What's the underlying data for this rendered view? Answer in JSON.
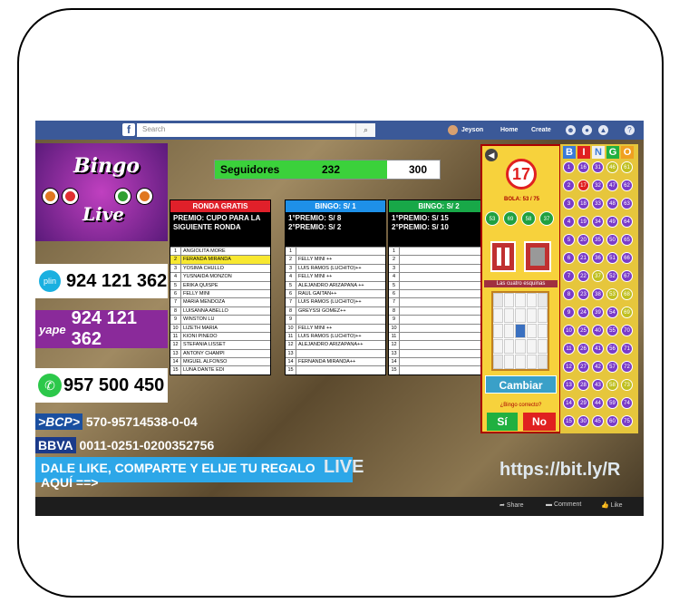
{
  "facebook": {
    "search_placeholder": "Search",
    "user": "Jeyson",
    "home": "Home",
    "create": "Create"
  },
  "stream": {
    "logo_line1": "Bingo",
    "logo_line2": "Live",
    "plin_label": "plin",
    "plin_number": "924 121 362",
    "yape_label": "yape",
    "yape_number": "924 121 362",
    "whatsapp_number": "957 500 450",
    "bcp_label": ">BCP>",
    "bcp_account": "570-95714538-0-04",
    "bbva_label": "BBVA",
    "bbva_account": "0011-0251-0200352756",
    "banner_text": "DALE LIKE, COMPARTE Y ELIJE TU REGALO AQUÍ ==>",
    "live_text": "LIVE",
    "url_text": "https://bit.ly/R",
    "seguidores_label": "Seguidores",
    "seguidores_count": "232",
    "seguidores_goal": "300"
  },
  "tables": [
    {
      "header": "RONDA GRATIS",
      "header_color": "#e0202a",
      "premio": "PREMIO: CUPO PARA LA SIGUIENTE RONDA",
      "rows": [
        "ANGIOLITA MORE",
        "FERANDA MIRANDA",
        "YOSIMA CHULLO",
        "YUSNAIDA MONZON",
        "ERIKA QUISPE",
        "FELLY MINI",
        "MARIA MENDOZA",
        "LUISANNA ABELLO",
        "WINSTON LU",
        "LIZETH MARIA",
        "KIONI PINEDO",
        "STEFANIA LISSET",
        "ANTONY CHAMPI",
        "MIGUEL ALFONSO",
        "LUNA DANTE EDI"
      ]
    },
    {
      "header": "BINGO: S/ 1",
      "header_color": "#1e90e8",
      "premio": "1°PREMIO: S/ 8\n2°PREMIO: S/ 2",
      "rows": [
        "",
        "FELLY MINI ++",
        "LUIS RAMOS (LUCHITO)++",
        "FELLY MINI ++",
        "ALEJANDRO ARIZAPANA ++",
        "RAUL GAITAN++",
        "LUIS RAMOS (LUCHITO)++",
        "GREYSSI GOMEZ++",
        "",
        "FELLY MINI ++",
        "LUIS RAMOS (LUCHITO)++",
        "ALEJANDRO ARIZAPANA++",
        "",
        "FERNANDA MIRANDA++",
        ""
      ]
    },
    {
      "header": "BINGO: S/ 2",
      "header_color": "#18a848",
      "premio": "1°PREMIO: S/ 15\n2°PREMIO: S/ 10",
      "rows": [
        "",
        "",
        "",
        "",
        "",
        "",
        "",
        "",
        "",
        "",
        "",
        "",
        "",
        "",
        ""
      ]
    }
  ],
  "game": {
    "current_ball": "17",
    "bola_label": "BOLA: 53 / 75",
    "recent_balls": [
      "53",
      "69",
      "58",
      "37"
    ],
    "pattern_label": "Las cuatro esquinas",
    "cambiar": "Cambiar",
    "bingo_question": "¿Bingo correcto?",
    "yes": "Sí",
    "no": "No",
    "bingo_letters": [
      "B",
      "I",
      "N",
      "G",
      "O"
    ],
    "balls": [
      [
        "1",
        "16",
        "31",
        "46",
        "61"
      ],
      [
        "2",
        "17",
        "32",
        "47",
        "62"
      ],
      [
        "3",
        "18",
        "33",
        "48",
        "63"
      ],
      [
        "4",
        "19",
        "34",
        "49",
        "64"
      ],
      [
        "5",
        "20",
        "35",
        "50",
        "65"
      ],
      [
        "6",
        "21",
        "36",
        "51",
        "66"
      ],
      [
        "7",
        "22",
        "37",
        "52",
        "67"
      ],
      [
        "8",
        "23",
        "38",
        "53",
        "68"
      ],
      [
        "9",
        "24",
        "39",
        "54",
        "69"
      ],
      [
        "10",
        "25",
        "40",
        "55",
        "70"
      ],
      [
        "11",
        "26",
        "41",
        "56",
        "71"
      ],
      [
        "12",
        "27",
        "42",
        "57",
        "72"
      ],
      [
        "13",
        "28",
        "43",
        "58",
        "73"
      ],
      [
        "14",
        "29",
        "44",
        "59",
        "74"
      ],
      [
        "15",
        "30",
        "45",
        "60",
        "75"
      ]
    ]
  },
  "actions": {
    "share": "Share",
    "comment": "Comment",
    "like": "Like"
  }
}
